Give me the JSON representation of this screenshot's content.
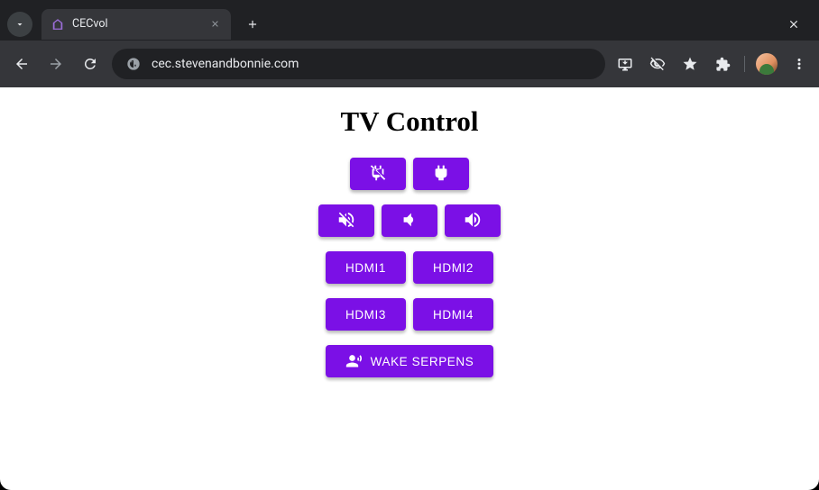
{
  "browser": {
    "tab_title": "CECvol",
    "url": "cec.stevenandbonnie.com"
  },
  "page": {
    "title": "TV Control",
    "power": {
      "off_icon": "power-off-icon",
      "on_icon": "power-plug-icon"
    },
    "volume": {
      "mute_icon": "volume-mute-icon",
      "down_icon": "volume-down-icon",
      "up_icon": "volume-up-icon"
    },
    "inputs": {
      "hdmi1": "HDMI1",
      "hdmi2": "HDMI2",
      "hdmi3": "HDMI3",
      "hdmi4": "HDMI4"
    },
    "wake": {
      "icon": "wake-voice-icon",
      "label": "WAKE SERPENS"
    },
    "accent_color": "#7b10e6"
  }
}
